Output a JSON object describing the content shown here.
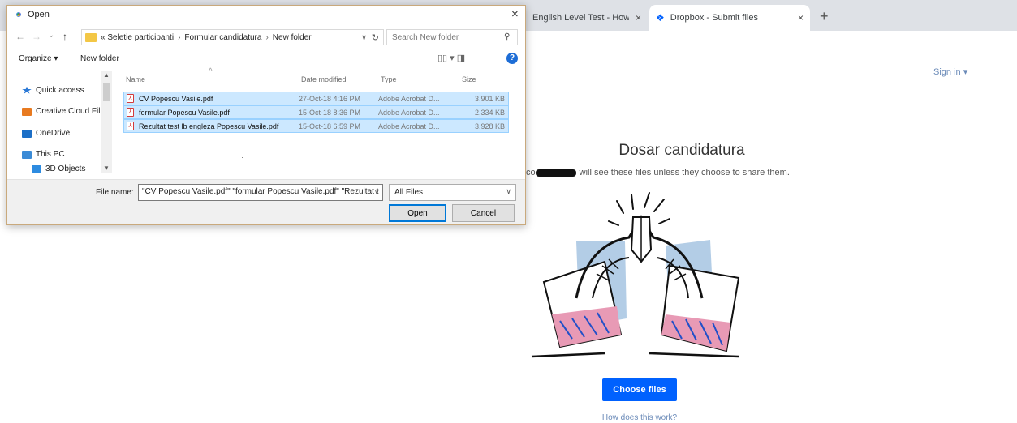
{
  "browser": {
    "tabs": [
      {
        "title": "English Level Test - How go",
        "close": "×"
      },
      {
        "title": "Dropbox - Submit files",
        "close": "×",
        "icon": "dropbox-icon"
      }
    ],
    "new_tab": "+"
  },
  "page": {
    "sign_in": "Sign in ▾",
    "title": "Dosar candidatura",
    "note": "will see these files unless they choose to share them.",
    "note_prefix": "co",
    "choose_files": "Choose files",
    "how_link": "How does this work?",
    "accent_color": "#0061fe"
  },
  "dialog": {
    "title": "Open",
    "close": "×",
    "nav": {
      "back": "←",
      "forward": "→",
      "recent": "⌄",
      "up": "↑"
    },
    "breadcrumb": [
      "«  Seletie participanti",
      "Formular candidatura",
      "New folder"
    ],
    "breadcrumb_sep": "›",
    "search_placeholder": "Search New folder",
    "organize": "Organize ▾",
    "new_folder": "New folder",
    "view_icons": "▯▯ ▾   ◨",
    "help": "?",
    "nav_items": [
      "Quick access",
      "Creative Cloud Fil",
      "OneDrive",
      "This PC",
      "3D Objects"
    ],
    "columns": {
      "name": "Name",
      "date": "Date modified",
      "type": "Type",
      "size": "Size"
    },
    "files": [
      {
        "name": "CV Popescu Vasile.pdf",
        "date": "27-Oct-18 4:16 PM",
        "type": "Adobe Acrobat D...",
        "size": "3,901 KB"
      },
      {
        "name": "formular Popescu Vasile.pdf",
        "date": "15-Oct-18 8:36 PM",
        "type": "Adobe Acrobat D...",
        "size": "2,334 KB"
      },
      {
        "name": "Rezultat test lb engleza Popescu Vasile.pdf",
        "date": "15-Oct-18 6:59 PM",
        "type": "Adobe Acrobat D...",
        "size": "3,928 KB"
      }
    ],
    "file_name_label": "File name:",
    "file_name_value": "\"CV Popescu Vasile.pdf\" \"formular Popescu Vasile.pdf\" \"Rezultat t",
    "file_type": "All Files",
    "open_button": "Open",
    "cancel_button": "Cancel"
  }
}
